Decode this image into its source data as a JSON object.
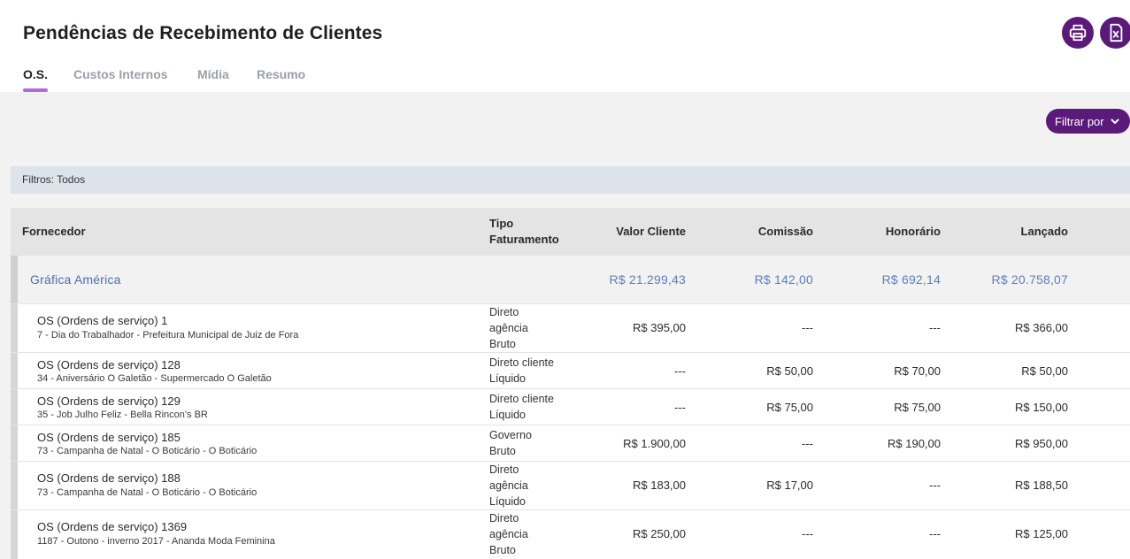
{
  "page": {
    "title": "Pendências de Recebimento de Clientes",
    "tabs": [
      {
        "label": "O.S.",
        "active": true
      },
      {
        "label": "Custos Internos",
        "active": false
      },
      {
        "label": "Mídia",
        "active": false
      },
      {
        "label": "Resumo",
        "active": false
      }
    ],
    "actions": {
      "print_icon": "printer-icon",
      "excel_icon": "excel-export-icon"
    }
  },
  "toolbar": {
    "filter_label": "Filtrar por",
    "filter_icon": "chevron-down-icon"
  },
  "filters_bar": {
    "text": "Filtros: Todos"
  },
  "colors": {
    "accent": "#5a1a7a",
    "tab_underline": "#b06bd9",
    "link_blue": "#4a6fb0",
    "filters_bg": "#dde3ea"
  },
  "table": {
    "headers": {
      "fornecedor": "Fornecedor",
      "tipo_line1": "Tipo",
      "tipo_line2": "Faturamento",
      "valor_cliente": "Valor Cliente",
      "comissao": "Comissão",
      "honorario": "Honorário",
      "lancado": "Lançado"
    },
    "group": {
      "name": "Gráfica América",
      "valor_cliente": "R$ 21.299,43",
      "comissao": "R$ 142,00",
      "honorario": "R$ 692,14",
      "lancado": "R$ 20.758,07"
    },
    "rows": [
      {
        "title": "OS (Ordens de serviço) 1",
        "subtitle": "7 - Dia do Trabalhador - Prefeitura Municipal de Juiz de Fora",
        "tipo": [
          "Direto",
          "agência",
          "Bruto"
        ],
        "valor_cliente": "R$ 395,00",
        "comissao": "---",
        "honorario": "---",
        "lancado": "R$ 366,00"
      },
      {
        "title": "OS (Ordens de serviço) 128",
        "subtitle": "34 - Aniversário O Galetão - Supermercado O Galetão",
        "tipo": [
          "Direto cliente",
          "Líquido"
        ],
        "valor_cliente": "---",
        "comissao": "R$ 50,00",
        "honorario": "R$ 70,00",
        "lancado": "R$ 50,00"
      },
      {
        "title": "OS (Ordens de serviço) 129",
        "subtitle": "35 - Job Julho Feliz - Bella Rincon's BR",
        "tipo": [
          "Direto cliente",
          "Líquido"
        ],
        "valor_cliente": "---",
        "comissao": "R$ 75,00",
        "honorario": "R$ 75,00",
        "lancado": "R$ 150,00"
      },
      {
        "title": "OS (Ordens de serviço) 185",
        "subtitle": "73 - Campanha de Natal - O Boticário - O Boticário",
        "tipo": [
          "Governo",
          "Bruto"
        ],
        "valor_cliente": "R$ 1.900,00",
        "comissao": "---",
        "honorario": "R$ 190,00",
        "lancado": "R$ 950,00"
      },
      {
        "title": "OS (Ordens de serviço) 188",
        "subtitle": "73 - Campanha de Natal - O Boticário - O Boticário",
        "tipo": [
          "Direto",
          "agência",
          "Líquido"
        ],
        "valor_cliente": "R$ 183,00",
        "comissao": "R$ 17,00",
        "honorario": "---",
        "lancado": "R$ 188,50"
      },
      {
        "title": "OS (Ordens de serviço) 1369",
        "subtitle": "1187 - Outono - inverno 2017 - Ananda Moda Feminina",
        "tipo": [
          "Direto",
          "agência",
          "Bruto"
        ],
        "valor_cliente": "R$ 250,00",
        "comissao": "---",
        "honorario": "---",
        "lancado": "R$ 125,00"
      }
    ]
  }
}
